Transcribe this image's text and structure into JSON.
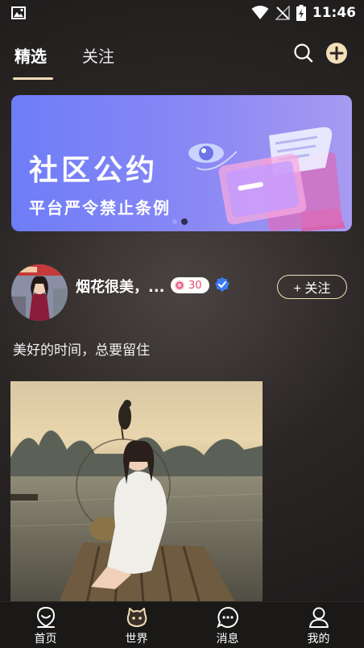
{
  "status_bar": {
    "time": "11:46",
    "icons": [
      "image-notification-icon",
      "wifi-icon",
      "no-signal-icon",
      "battery-charging-icon"
    ]
  },
  "header": {
    "tabs": [
      {
        "label": "精选",
        "active": true
      },
      {
        "label": "关注",
        "active": false
      }
    ],
    "accent": "#f3dfb8",
    "icons": [
      "search-icon",
      "add-circle-icon"
    ]
  },
  "banner": {
    "title": "社区公约",
    "subtitle": "平台严令禁止条例",
    "slide_count": 2,
    "active_slide": 2,
    "gradient": [
      "#6e7df8",
      "#a79bf1"
    ]
  },
  "post": {
    "username": "烟花很美，...",
    "level": "30",
    "follow_label": "+ 关注",
    "text": "美好的时间，总要留住",
    "level_color": "#e24b74",
    "verified_color": "#3b7cf5"
  },
  "bottom_nav": {
    "items": [
      {
        "label": "首页",
        "icon": "location-face-icon"
      },
      {
        "label": "世界",
        "icon": "world-mascot-icon",
        "active": true
      },
      {
        "label": "消息",
        "icon": "chat-bubble-icon"
      },
      {
        "label": "我的",
        "icon": "user-profile-icon"
      }
    ]
  }
}
